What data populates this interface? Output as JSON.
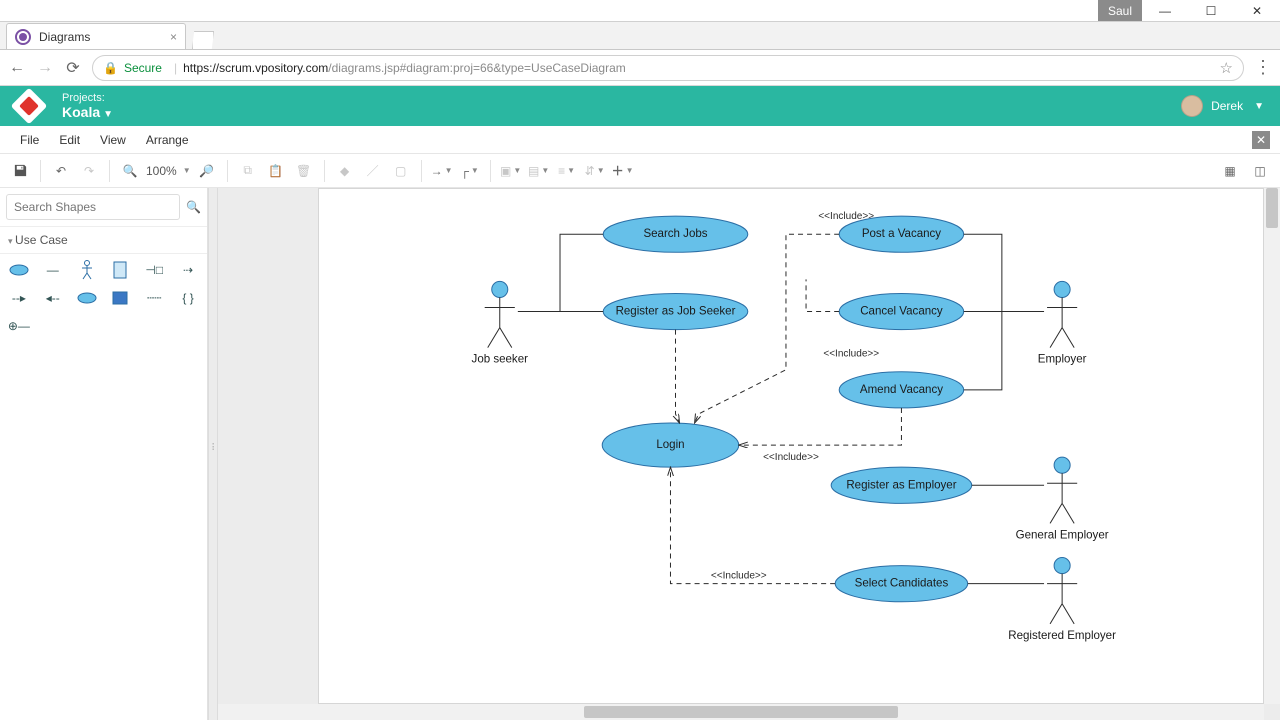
{
  "window": {
    "user_tag": "Saul"
  },
  "browser": {
    "tab_title": "Diagrams",
    "secure_label": "Secure",
    "url_host": "https://scrum.vpository.com",
    "url_path": "/diagrams.jsp#diagram:proj=66&type=UseCaseDiagram"
  },
  "header": {
    "projects_label": "Projects:",
    "project_name": "Koala",
    "user_name": "Derek"
  },
  "menubar": {
    "file": "File",
    "edit": "Edit",
    "view": "View",
    "arrange": "Arrange"
  },
  "toolbar": {
    "zoom": "100%"
  },
  "sidebar": {
    "search_placeholder": "Search Shapes",
    "category": "Use Case"
  },
  "diagram": {
    "actors": {
      "job_seeker": "Job seeker",
      "employer": "Employer",
      "general_employer": "General Employer",
      "registered_employer": "Registered Employer"
    },
    "usecases": {
      "search_jobs": "Search Jobs",
      "register_job_seeker": "Register as Job Seeker",
      "post_vacancy": "Post a Vacancy",
      "cancel_vacancy": "Cancel Vacancy",
      "amend_vacancy": "Amend Vacancy",
      "login": "Login",
      "register_employer": "Register as Employer",
      "select_candidates": "Select Candidates"
    },
    "include_label": "<<Include>>"
  }
}
